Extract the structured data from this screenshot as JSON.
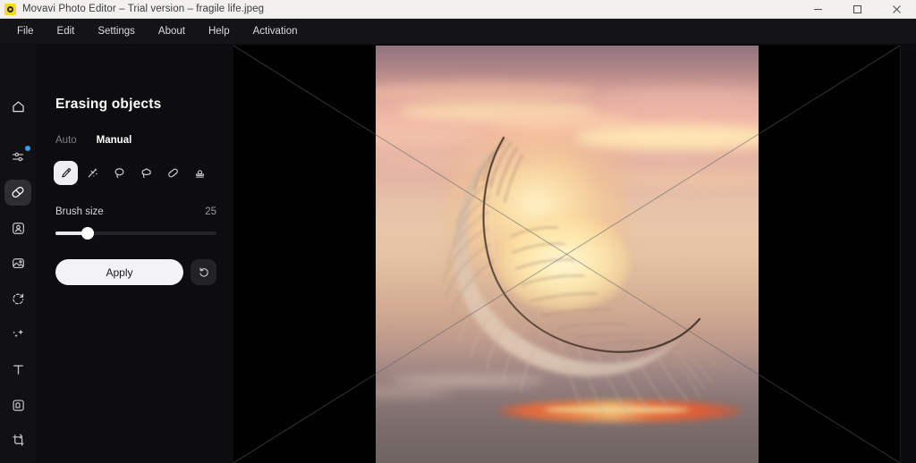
{
  "window": {
    "title": "Movavi Photo Editor – Trial version – fragile life.jpeg",
    "app_icon": "movavi-icon",
    "minimize_label": "–",
    "maximize_label": "□",
    "close_label": "✕"
  },
  "menu": {
    "items": [
      {
        "label": "File"
      },
      {
        "label": "Edit"
      },
      {
        "label": "Settings"
      },
      {
        "label": "About"
      },
      {
        "label": "Help"
      },
      {
        "label": "Activation"
      }
    ]
  },
  "rail": {
    "items": [
      {
        "name": "home",
        "icon": "home-icon",
        "active": false,
        "badge": false
      },
      {
        "name": "adjustments",
        "icon": "sliders-icon",
        "active": false,
        "badge": true
      },
      {
        "name": "erase-objects",
        "icon": "bandage-icon",
        "active": true,
        "badge": false
      },
      {
        "name": "portrait",
        "icon": "portrait-icon",
        "active": false,
        "badge": false
      },
      {
        "name": "background",
        "icon": "image-icon",
        "active": false,
        "badge": false
      },
      {
        "name": "restore",
        "icon": "restore-icon",
        "active": false,
        "badge": false
      },
      {
        "name": "ai-enhance",
        "icon": "sparkle-icon",
        "active": false,
        "badge": false
      },
      {
        "name": "text",
        "icon": "text-icon",
        "active": false,
        "badge": false
      },
      {
        "name": "frame",
        "icon": "frame-icon",
        "active": false,
        "badge": false
      },
      {
        "name": "crop",
        "icon": "crop-rotate-icon",
        "active": false,
        "badge": false
      }
    ]
  },
  "panel": {
    "title": "Erasing objects",
    "tabs": [
      {
        "label": "Auto",
        "active": false
      },
      {
        "label": "Manual",
        "active": true
      }
    ],
    "tools": [
      {
        "name": "brush",
        "icon": "brush-icon",
        "active": true
      },
      {
        "name": "magic-wand",
        "icon": "magic-wand-icon",
        "active": false
      },
      {
        "name": "lasso",
        "icon": "lasso-icon",
        "active": false
      },
      {
        "name": "polygon-lasso",
        "icon": "polygon-lasso-icon",
        "active": false
      },
      {
        "name": "eraser",
        "icon": "eraser-icon",
        "active": false
      },
      {
        "name": "stamp",
        "icon": "stamp-icon",
        "active": false
      }
    ],
    "brush_size": {
      "label": "Brush size",
      "value": "25",
      "percent": 20
    },
    "apply_label": "Apply",
    "reset_icon": "reset-icon"
  },
  "canvas": {
    "watermark": "trial-x-overlay",
    "image_name": "feather-sunset-photo"
  },
  "colors": {
    "accent_blue": "#2e9df2",
    "panel_bg": "#0d0d0f",
    "rail_bg": "#111113",
    "menubar_bg": "#141416",
    "titlebar_bg": "#f2f1f0",
    "apply_bg": "#f3f3f5"
  }
}
